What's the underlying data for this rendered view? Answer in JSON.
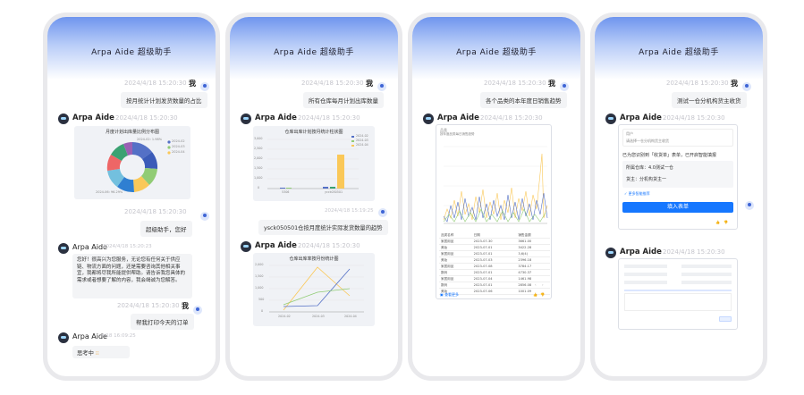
{
  "app_title": "Arpa Aide 超级助手",
  "user_name": "我",
  "bot_name": "Arpa Aide",
  "panel1": {
    "m1_time": "2024/4/18 15:20:30",
    "m1_text": "按月统计计划发货数量的占比",
    "bot1_time": "2024/4/18 15:20:30",
    "pie_title": "月度计划出库量比例分布图",
    "pie_labels": [
      "2024-02: 1.98%",
      "2024-06: 96.29%"
    ],
    "pie_legend": [
      "2024-02",
      "2024-03",
      "2024-04"
    ],
    "m2_time": "2024/4/18 15:20:30",
    "m2_text": "超级助手，您好",
    "bot2_time": "2024/4/18 15:20:23",
    "bot2_text": "您好！很高兴为您服务，无论您有任何关于供应链、物流方面的问题，还是需要咨询其他相关事宜，我都将尽我所能提供帮助。请告诉我您具体的需求或者想要了解的内容，我会竭诚为您解答。",
    "m3_time": "2024/4/18 15:20:30",
    "m3_text": "帮我打印今天的订单",
    "bot3_time": "4/18 16:09:25",
    "bot3_text": "思考中"
  },
  "panel2": {
    "m1_time": "2024/4/18 15:20:30",
    "m1_text": "所有仓库每月计划出库数量",
    "bot1_time": "2024/4/18 15:20:30",
    "bar_title": "仓库出库计划按月统计柱状图",
    "bar_legend": [
      "2024-02",
      "2024-03",
      "2024-04"
    ],
    "bar_yticks": [
      "3,000",
      "2,500",
      "2,000",
      "1,500",
      "1,000",
      "500",
      "0"
    ],
    "bar_xticks": [
      "5306",
      "ycck050501"
    ],
    "m2_time": "2024/4/18 15:19:25",
    "m2_text": "ysck050501仓按月度统计实际发货数量的趋势",
    "bot2_time": "2024/4/18 15:20:30",
    "line_title": "仓库出库率按月份统计图",
    "line_yticks": [
      "2,000",
      "1,500",
      "1,000",
      "500",
      "0"
    ],
    "line_xticks": [
      "2024-02",
      "2024-03",
      "2024-04"
    ]
  },
  "panel3": {
    "m1_time": "2024/4/18 15:20:30",
    "m1_text": "各个品类的本年度日销售趋势",
    "bot1_time": "2024/4/18 15:20:30",
    "chart_title": "品类",
    "chart_subtitle": "按年度品类每日销售趋势",
    "table_headers": [
      "品类名称",
      "日期",
      "销售金额"
    ],
    "table_rows": [
      [
        "家居用品",
        "2023-07-30",
        "3661.00"
      ],
      [
        "美妆",
        "2023-07-01",
        "3422.28"
      ],
      [
        "家居用品",
        "2023-07-01",
        "3,6(4)"
      ],
      [
        "美妆",
        "2023-07-03",
        "2396.18"
      ],
      [
        "家居用品",
        "2023-07-08",
        "3784.17"
      ],
      [
        "数码",
        "2023-07-01",
        "4730.37"
      ],
      [
        "家居用品",
        "2023-07-04",
        "1461.98"
      ],
      [
        "数码",
        "2023-07-01",
        "2856.08"
      ],
      [
        "美妆",
        "2023-07-06",
        "1001.09"
      ]
    ],
    "footer": "查看更多"
  },
  "panel4": {
    "m1_time": "2024/4/18 15:20:30",
    "m1_text": "测试一仓分机构货主收货",
    "bot1_time": "2024/4/18 15:20:30",
    "form_label": "用户",
    "form_placeholder": "请选择一仓分机构货主收货",
    "form_result": "已为您识别到「收货单」表单，已开启智能填报",
    "field1": "所属仓库：4.0测试一仓",
    "field2": "货主：分机构货主一",
    "more_link": "更多智能推荐",
    "fill_button": "填入表单",
    "bot2_time": "2024/4/18 15:20:30"
  }
}
